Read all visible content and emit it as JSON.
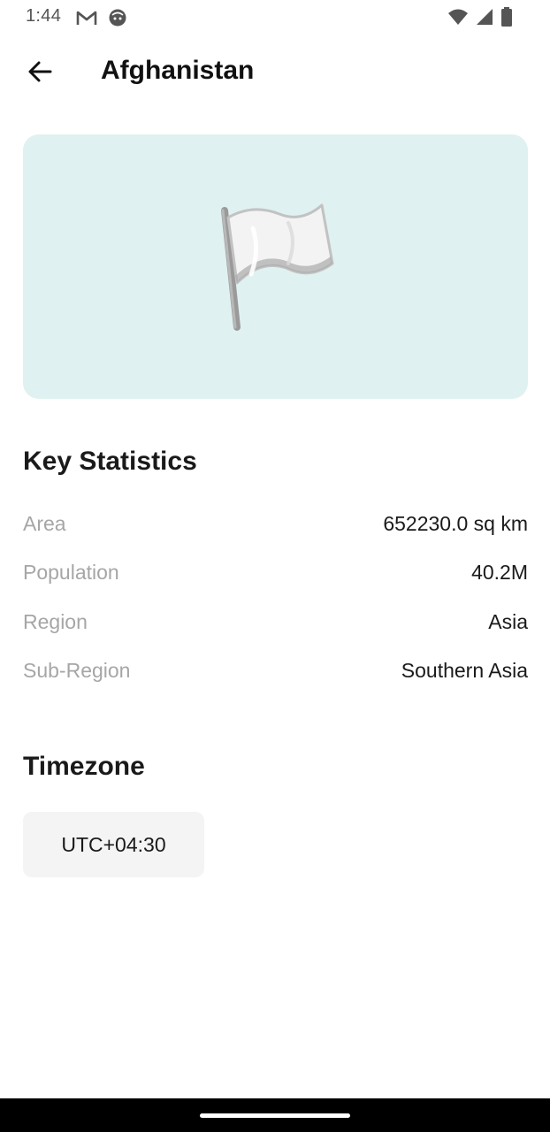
{
  "status_bar": {
    "time": "1:44",
    "left_icons": [
      "gmail-icon",
      "notification-face-icon"
    ],
    "right_icons": [
      "wifi-icon",
      "signal-icon",
      "battery-icon"
    ]
  },
  "app_bar": {
    "title": "Afghanistan",
    "back_icon": "arrow-back-icon"
  },
  "flag_card": {
    "flag_icon": "white-flag-icon",
    "background_color": "#dff1f0"
  },
  "key_statistics": {
    "title": "Key Statistics",
    "rows": [
      {
        "label": "Area",
        "value": "652230.0 sq km"
      },
      {
        "label": "Population",
        "value": "40.2M"
      },
      {
        "label": "Region",
        "value": "Asia"
      },
      {
        "label": "Sub-Region",
        "value": "Southern Asia"
      }
    ]
  },
  "timezone": {
    "title": "Timezone",
    "items": [
      "UTC+04:30"
    ]
  }
}
